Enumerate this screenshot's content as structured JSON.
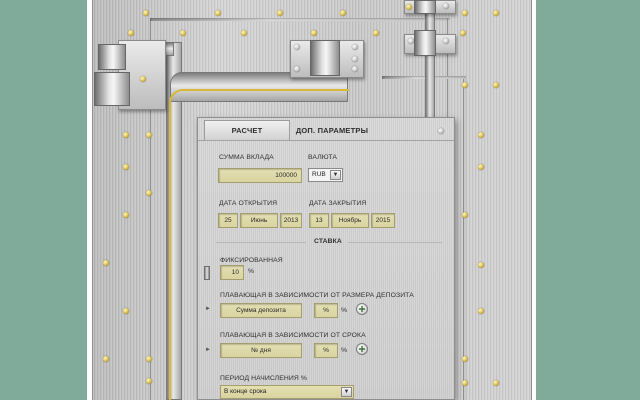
{
  "tabs": [
    {
      "label": "РАСЧЕТ"
    },
    {
      "label": "ДОП. ПАРАМЕТРЫ"
    }
  ],
  "deposit": {
    "label": "СУММА ВКЛАДА",
    "value": "100000"
  },
  "currency": {
    "label": "ВАЛЮТА",
    "value": "RUB",
    "arrow_icon": "chevron-down-icon"
  },
  "open_date": {
    "label": "ДАТА ОТКРЫТИЯ",
    "day": "25",
    "month": "Июнь",
    "year": "2013"
  },
  "close_date": {
    "label": "ДАТА ЗАКРЫТИЯ",
    "day": "13",
    "month": "Ноябрь",
    "year": "2015"
  },
  "rate": {
    "heading": "СТАВКА",
    "fixed": {
      "label": "ФИКСИРОВАННАЯ",
      "value": "10",
      "unit": "%"
    },
    "by_amount": {
      "label": "ПЛАВАЮЩАЯ В ЗАВИСИМОСТИ ОТ РАЗМЕРА ДЕПОЗИТА",
      "placeholder": "Сумма депозита",
      "pct_value": "%",
      "unit": "%"
    },
    "by_term": {
      "label": "ПЛАВАЮЩАЯ В ЗАВИСИМОСТИ ОТ СРОКА",
      "placeholder": "№ дня",
      "pct_value": "%",
      "unit": "%"
    }
  },
  "period": {
    "label": "ПЕРИОД НАЧИСЛЕНИЯ %",
    "value": "В конце срока"
  },
  "colors": {
    "background": "#80ab9a",
    "field": "#e0dcaa",
    "wire": "#d9b935"
  }
}
